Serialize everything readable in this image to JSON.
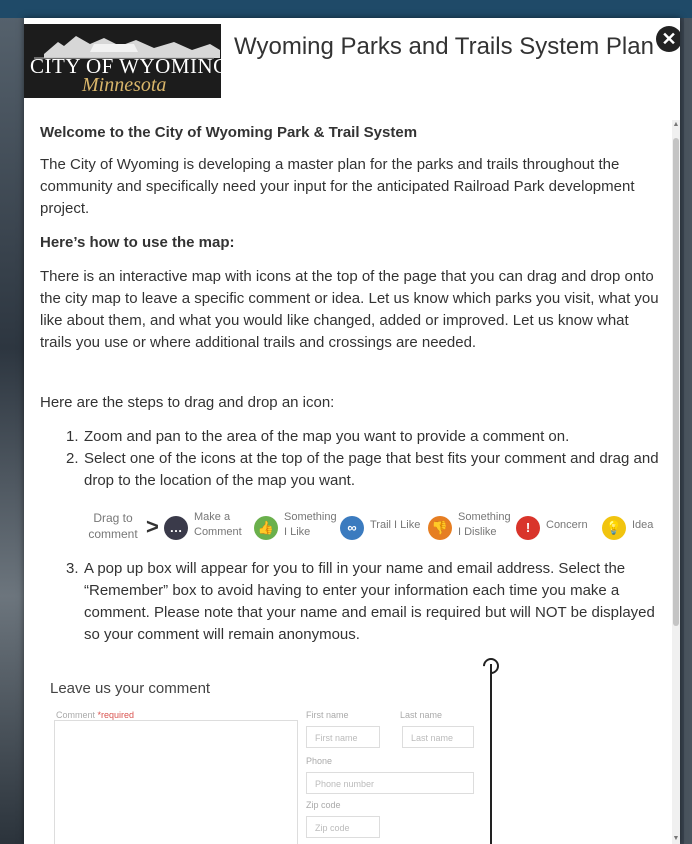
{
  "logo": {
    "city_text": "CITY OF WYOMING",
    "state_text": "Minnesota"
  },
  "modal": {
    "title": "Wyoming Parks and Trails System Plan"
  },
  "content": {
    "welcome_heading": "Welcome to the City of Wyoming Park & Trail System",
    "intro": "The City of Wyoming is developing a master plan for the parks and trails throughout the community and specifically need your input for the anticipated Railroad Park development project.",
    "howto_heading": "Here’s how to use the map:",
    "howto_text": "There is an interactive map with icons at the top of the page that you can drag and drop onto the city map to leave a specific comment or idea. Let us know which parks you visit, what you like about them, and what you would like changed, added or improved. Let us know what trails you use or where additional trails and crossings are needed.",
    "steps_intro": "Here are the steps to drag and drop an icon:",
    "steps": [
      {
        "num": "1.",
        "text": "Zoom and pan to the area of the map you want to provide a comment on."
      },
      {
        "num": "2.",
        "text": "Select one of the icons at the top of the page that best fits your comment and drag and drop to the location of the map you want."
      },
      {
        "num": "3.",
        "text": "A pop up box will appear for you to fill in your name and email address. Select the “Remember” box to avoid having to enter your information each time you make a comment. Please note that your name and email is required but will NOT be displayed so your comment will remain anonymous."
      }
    ]
  },
  "icon_legend": {
    "drag_label": "Drag to comment",
    "items": [
      {
        "label": "Make a Comment",
        "color": "#3a3a4a",
        "icon": "comment-icon",
        "glyph": "…"
      },
      {
        "label": "Something I Like",
        "color": "#6ab04c",
        "icon": "thumbs-up-icon",
        "glyph": "👍"
      },
      {
        "label": "Trail I Like",
        "color": "#3b7bbf",
        "icon": "bike-icon",
        "glyph": "∞"
      },
      {
        "label": "Something I Dislike",
        "color": "#e67e22",
        "icon": "thumbs-down-icon",
        "glyph": "👎"
      },
      {
        "label": "Concern",
        "color": "#d9342b",
        "icon": "exclamation-icon",
        "glyph": "!"
      },
      {
        "label": "Idea",
        "color": "#f1c40f",
        "icon": "lightbulb-icon",
        "glyph": "💡"
      }
    ]
  },
  "comment_form": {
    "heading": "Leave us your comment",
    "comment_label": "Comment",
    "required_label": "*required",
    "first_name_label": "First name",
    "first_name_placeholder": "First name",
    "last_name_label": "Last name",
    "last_name_placeholder": "Last name",
    "phone_label": "Phone",
    "phone_placeholder": "Phone number",
    "zip_label": "Zip code",
    "zip_placeholder": "Zip code"
  }
}
